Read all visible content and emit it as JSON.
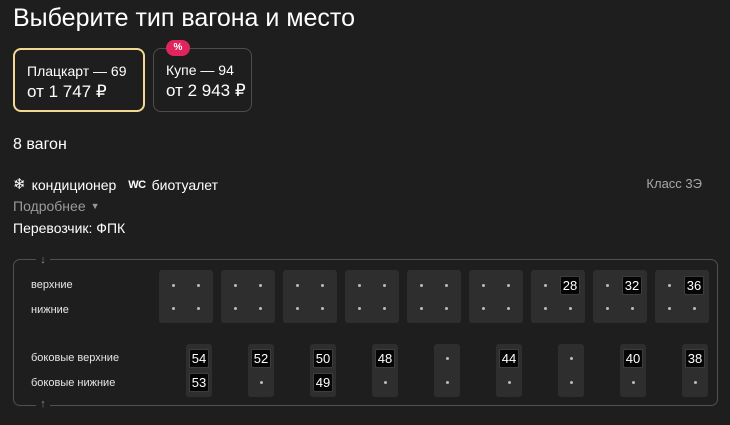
{
  "page": {
    "title": "Выберите тип вагона и место"
  },
  "car_types": [
    {
      "name": "Плацкарт — 69",
      "price": "от 1 747 ₽",
      "selected": true
    },
    {
      "name": "Купе — 94",
      "price": "от 2 943 ₽",
      "selected": false,
      "badge": "%"
    }
  ],
  "car": {
    "number_label": "8 вагон",
    "features": [
      {
        "icon": "snowflake-icon",
        "glyph": "❄",
        "label": "кондиционер"
      },
      {
        "icon": "wc-icon",
        "glyph": "WC",
        "label": "биотуалет"
      }
    ],
    "class_label": "Класс 3Э",
    "details_label": "Подробнее",
    "carrier_label": "Перевозчик: ФПК"
  },
  "scheme": {
    "row_labels": {
      "upper": "верхние",
      "lower": "нижние",
      "side_upper": "боковые верхние",
      "side_lower": "боковые нижние"
    },
    "compartments": [
      {
        "upper": [
          null,
          null
        ],
        "lower": [
          null,
          null
        ]
      },
      {
        "upper": [
          null,
          null
        ],
        "lower": [
          null,
          null
        ]
      },
      {
        "upper": [
          null,
          null
        ],
        "lower": [
          null,
          null
        ]
      },
      {
        "upper": [
          null,
          null
        ],
        "lower": [
          null,
          null
        ]
      },
      {
        "upper": [
          null,
          null
        ],
        "lower": [
          null,
          null
        ]
      },
      {
        "upper": [
          null,
          null
        ],
        "lower": [
          null,
          null
        ]
      },
      {
        "upper": [
          null,
          "28"
        ],
        "lower": [
          null,
          null
        ]
      },
      {
        "upper": [
          null,
          "32"
        ],
        "lower": [
          null,
          null
        ]
      },
      {
        "upper": [
          null,
          "36"
        ],
        "lower": [
          null,
          null
        ]
      }
    ],
    "side": [
      {
        "upper": "54",
        "lower": "53"
      },
      {
        "upper": "52",
        "lower": null
      },
      {
        "upper": "50",
        "lower": "49"
      },
      {
        "upper": "48",
        "lower": null
      },
      {
        "upper": null,
        "lower": null
      },
      {
        "upper": "44",
        "lower": null
      },
      {
        "upper": null,
        "lower": null
      },
      {
        "upper": "40",
        "lower": null
      },
      {
        "upper": "38",
        "lower": null
      }
    ],
    "door_glyphs": {
      "top": "↓",
      "bottom": "↑"
    }
  }
}
